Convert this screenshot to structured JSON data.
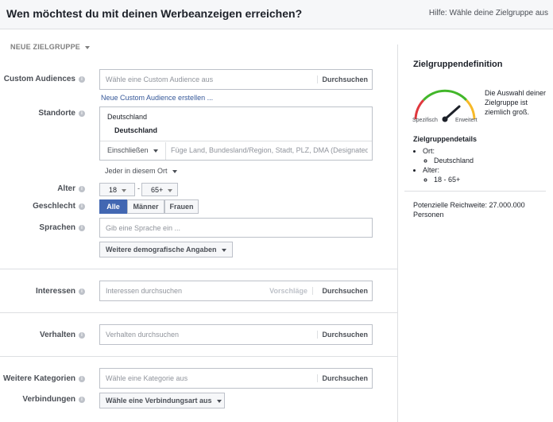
{
  "header": {
    "title": "Wen möchtest du mit deinen Werbeanzeigen erreichen?",
    "help_link": "Hilfe: Wähle deine Zielgruppe aus"
  },
  "new_audience": {
    "label": "NEUE ZIELGRUPPE"
  },
  "custom_audiences": {
    "label": "Custom Audiences",
    "placeholder": "Wähle eine Custom Audience aus",
    "button": "Durchsuchen",
    "create_link": "Neue Custom Audience erstellen ..."
  },
  "locations": {
    "label": "Standorte",
    "country": "Deutschland",
    "selected": "Deutschland",
    "include_label": "Einschließen",
    "placeholder": "Füge Land, Bundesland/Region, Stadt, PLZ, DMA (Designated",
    "everyone_option": "Jeder in diesem Ort"
  },
  "age": {
    "label": "Alter",
    "min": "18",
    "max": "65+",
    "separator": "-"
  },
  "gender": {
    "label": "Geschlecht",
    "options": [
      "Alle",
      "Männer",
      "Frauen"
    ],
    "selected": "Alle"
  },
  "languages": {
    "label": "Sprachen",
    "placeholder": "Gib eine Sprache ein ..."
  },
  "more_demographics": {
    "label": "Weitere demografische Angaben"
  },
  "interests": {
    "label": "Interessen",
    "placeholder": "Interessen durchsuchen",
    "suggestions": "Vorschläge",
    "button": "Durchsuchen"
  },
  "behaviors": {
    "label": "Verhalten",
    "placeholder": "Verhalten durchsuchen",
    "button": "Durchsuchen"
  },
  "more_categories": {
    "label": "Weitere Kategorien",
    "placeholder": "Wähle eine Kategorie aus",
    "button": "Durchsuchen"
  },
  "connections": {
    "label": "Verbindungen",
    "dropdown": "Wähle eine Verbindungsart aus"
  },
  "sidebar": {
    "title": "Zielgruppendefinition",
    "gauge_left": "Spezifisch",
    "gauge_right": "Erweitert",
    "description": "Die Auswahl deiner Zielgruppe ist ziemlich groß.",
    "details_title": "Zielgruppendetails",
    "location_label": "Ort:",
    "location_value": "Deutschland",
    "age_label": "Alter:",
    "age_value": "18 - 65+",
    "reach": "Potenzielle Reichweite: 27.000.000 Personen"
  },
  "colors": {
    "accent": "#4267b2",
    "link": "#365899",
    "gauge_red": "#e0383e",
    "gauge_yellow": "#f7b928",
    "gauge_green": "#42b72a"
  }
}
